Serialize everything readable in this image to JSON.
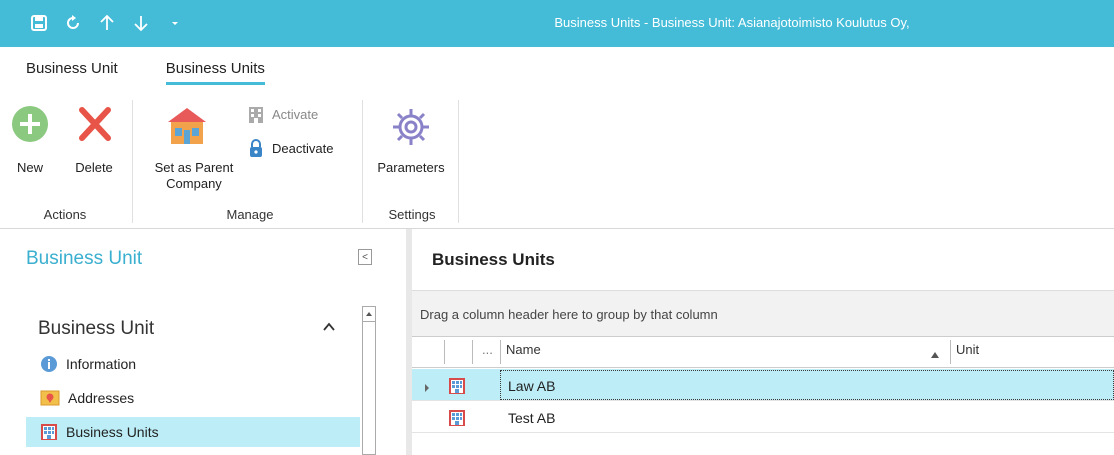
{
  "window": {
    "title": "Business Units - Business Unit: Asianajotoimisto Koulutus Oy,",
    "accent": "#44bcd8"
  },
  "qat": {
    "icons": [
      "save-icon",
      "refresh-icon",
      "arrow-up-icon",
      "arrow-down-icon",
      "dropdown-icon"
    ]
  },
  "ribbon": {
    "tabs": [
      {
        "label": "Business Unit",
        "active": false
      },
      {
        "label": "Business Units",
        "active": true
      }
    ],
    "groups": {
      "actions": {
        "label": "Actions",
        "new_label": "New",
        "delete_label": "Delete"
      },
      "manage": {
        "label": "Manage",
        "set_parent_label_1": "Set as Parent",
        "set_parent_label_2": "Company",
        "activate_label": "Activate",
        "deactivate_label": "Deactivate"
      },
      "settings": {
        "label": "Settings",
        "parameters_label": "Parameters"
      }
    }
  },
  "left_panel": {
    "title": "Business Unit",
    "collapse_glyph": "<",
    "section_title": "Business Unit",
    "items": [
      {
        "label": "Information",
        "active": false,
        "icon": "info-icon"
      },
      {
        "label": "Addresses",
        "active": false,
        "icon": "address-icon"
      },
      {
        "label": "Business Units",
        "active": true,
        "icon": "building-icon"
      }
    ]
  },
  "grid": {
    "title": "Business Units",
    "group_hint": "Drag a column header here to group by that column",
    "columns": {
      "ellipsis": "...",
      "name": "Name",
      "unit": "Unit"
    },
    "rows": [
      {
        "name": "Law AB",
        "selected": true
      },
      {
        "name": "Test AB",
        "selected": false
      }
    ]
  }
}
